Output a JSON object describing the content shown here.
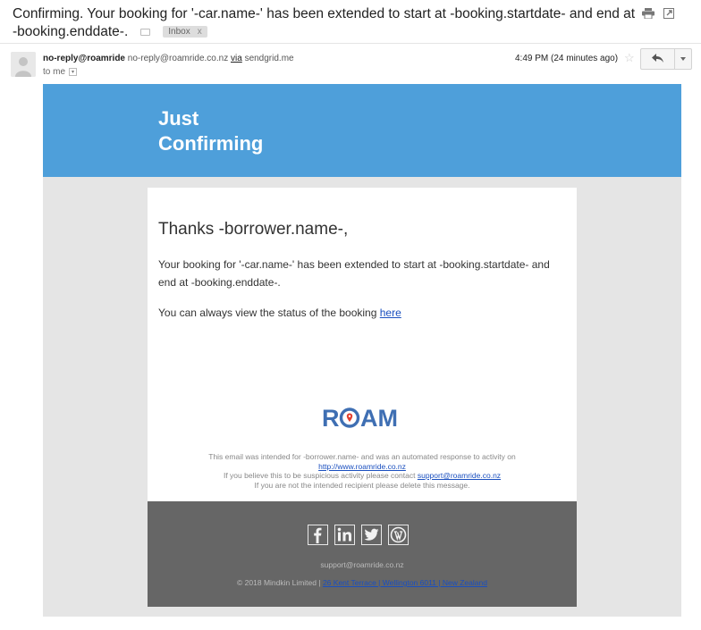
{
  "subject": {
    "text": "Confirming. Your booking for '-car.name-' has been extended to start at -booking.startdate- and end at -booking.enddate-.",
    "label": "Inbox",
    "label_remove": "x"
  },
  "sender": {
    "name": "no-reply@roamride",
    "email": "no-reply@roamride.co.nz",
    "via_label": "via",
    "via_domain": "sendgrid.me",
    "to": "to me"
  },
  "meta": {
    "time": "4:49 PM (24 minutes ago)"
  },
  "email": {
    "banner_line1": "Just",
    "banner_line2": "Confirming",
    "greeting": "Thanks -borrower.name-,",
    "paragraph1": "Your booking for '-car.name-' has been extended to start at -booking.startdate- and end at -booking.enddate-.",
    "paragraph2_prefix": "You can always view the status of the booking",
    "paragraph2_link": "here",
    "logo_text": "ROAM",
    "fine1": "This email was intended for -borrower.name- and was an automated response to activity on",
    "fine_link": "http://www.roamride.co.nz",
    "fine2_prefix": "If you believe this to be suspicious activity please contact",
    "fine2_link": "support@roamride.co.nz",
    "fine3": "If you are not the intended recipient please delete this message.",
    "footer_email": "support@roamride.co.nz",
    "footer_copyright": "© 2018 Mindkin Limited |",
    "footer_address": "26 Kent Terrace | Wellington 6011 | New Zealand"
  },
  "icons": {
    "print": "print-icon",
    "popout": "popout-icon",
    "star": "star-icon",
    "reply": "reply-icon",
    "more": "more-icon",
    "facebook": "facebook-icon",
    "linkedin": "linkedin-icon",
    "twitter": "twitter-icon",
    "wordpress": "wordpress-icon"
  },
  "colors": {
    "banner": "#4e9fda",
    "footer": "#666666",
    "link": "#1a4fbf",
    "logo": "#3f6fb3",
    "logo_accent": "#e2402f"
  }
}
